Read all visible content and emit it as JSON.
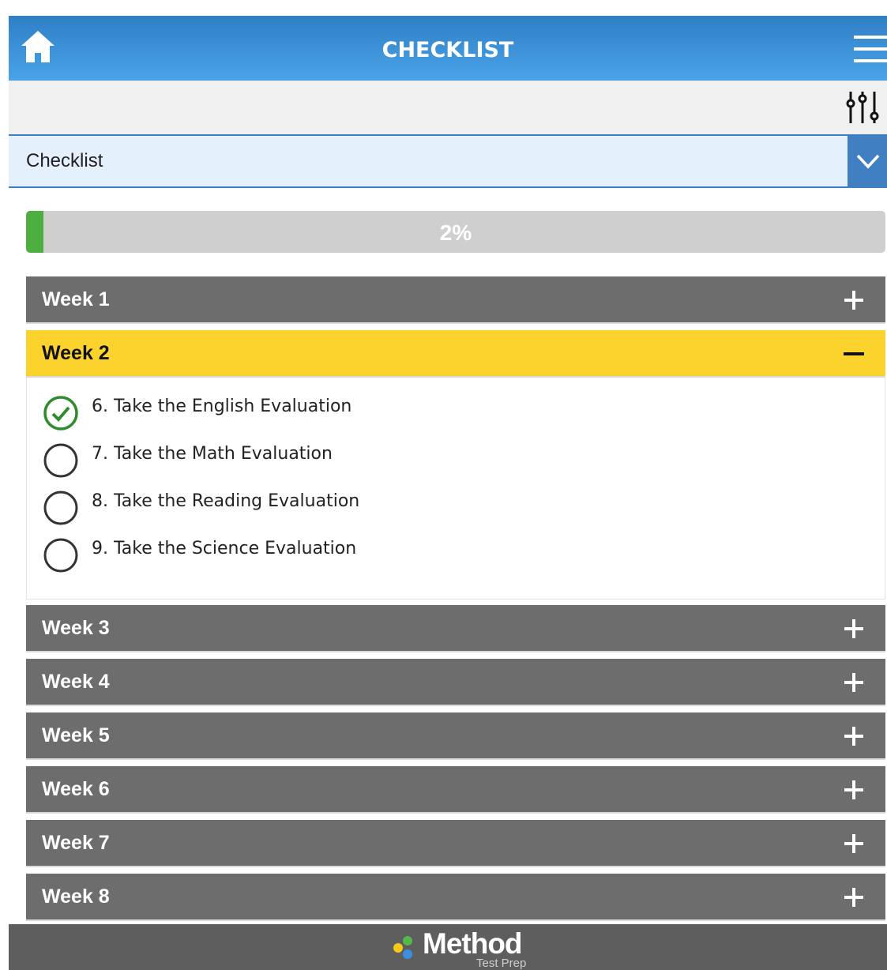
{
  "header": {
    "title": "CHECKLIST",
    "home_icon": "home-icon",
    "menu_icon": "hamburger-menu-icon"
  },
  "toolbar": {
    "filter_icon": "sliders-icon"
  },
  "select": {
    "value": "Checklist",
    "icon": "chevron-down-icon"
  },
  "progress": {
    "label": "2%",
    "fraction": 0.02,
    "color": "#4caf3f"
  },
  "weeks": [
    {
      "label": "Week 1",
      "expanded": false
    },
    {
      "label": "Week 2",
      "expanded": true
    },
    {
      "label": "Week 3",
      "expanded": false
    },
    {
      "label": "Week 4",
      "expanded": false
    },
    {
      "label": "Week 5",
      "expanded": false
    },
    {
      "label": "Week 6",
      "expanded": false
    },
    {
      "label": "Week 7",
      "expanded": false
    },
    {
      "label": "Week 8",
      "expanded": false
    }
  ],
  "tasks": [
    {
      "label": "6. Take the English Evaluation",
      "done": true
    },
    {
      "label": "7. Take the Math Evaluation",
      "done": false
    },
    {
      "label": "8. Take the Reading Evaluation",
      "done": false
    },
    {
      "label": "9. Take the Science Evaluation",
      "done": false
    }
  ],
  "footer": {
    "logo_name": "Method",
    "logo_sub": "Test Prep"
  },
  "colors": {
    "header": "#3a8fd6",
    "open_week": "#fcd22c",
    "closed_week": "#6d6d6d",
    "check": "#2e8b2e"
  }
}
